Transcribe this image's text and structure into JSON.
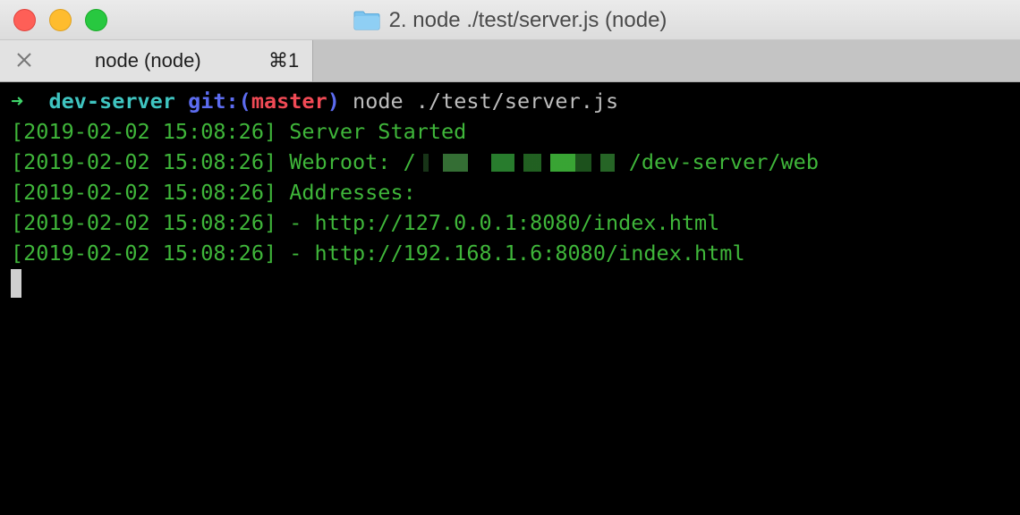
{
  "window": {
    "title": "2. node ./test/server.js (node)",
    "folder_icon": "folder-icon"
  },
  "tab": {
    "label": "node (node)",
    "shortcut": "⌘1",
    "close_icon": "close-icon"
  },
  "terminal": {
    "prompt": {
      "arrow": "➜",
      "dir": "dev-server",
      "git_prefix": "git:(",
      "branch": "master",
      "git_suffix": ")",
      "command": "node ./test/server.js"
    },
    "lines": [
      "[2019-02-02 15:08:26] Server Started",
      "[2019-02-02 15:08:26] Webroot: /",
      "/dev-server/web",
      "[2019-02-02 15:08:26] Addresses:",
      "[2019-02-02 15:08:26] - http://127.0.0.1:8080/index.html",
      "[2019-02-02 15:08:26] - http://192.168.1.6:8080/index.html"
    ]
  },
  "colors": {
    "output_green": "#3fb63a",
    "prompt_cyan": "#3fc4c0",
    "prompt_blue": "#5c6cf0",
    "prompt_red": "#f04a55",
    "background": "#000000"
  }
}
